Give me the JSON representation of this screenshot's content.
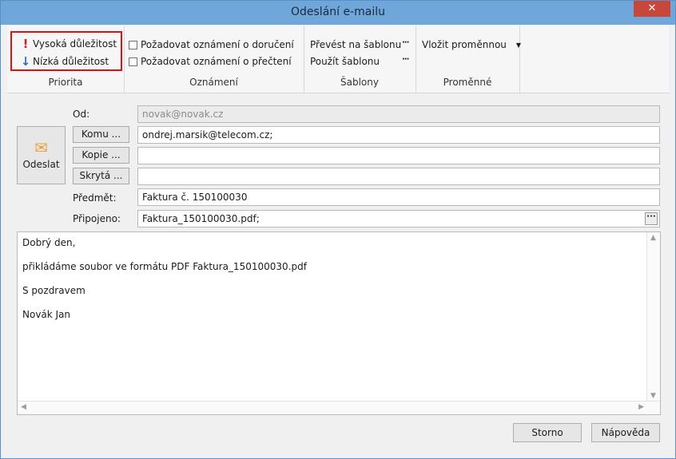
{
  "window": {
    "title": "Odeslání e-mailu",
    "close_label": "✕"
  },
  "ribbon": {
    "priority": {
      "high": "Vysoká důležitost",
      "low": "Nízká důležitost",
      "label": "Priorita"
    },
    "notifications": {
      "delivery": "Požadovat oznámení o doručení",
      "read": "Požadovat oznámení o přečtení",
      "label": "Oznámení"
    },
    "templates": {
      "convert": "Převést na šablonu",
      "use": "Použít šablonu",
      "label": "Šablony"
    },
    "variables": {
      "insert": "Vložit proměnnou",
      "label": "Proměnné"
    }
  },
  "form": {
    "send_label": "Odeslat",
    "from_label": "Od:",
    "from_value": "novak@novak.cz",
    "to_button": "Komu ...",
    "to_value": "ondrej.marsik@telecom.cz;",
    "cc_button": "Kopie ...",
    "cc_value": "",
    "bcc_button": "Skrytá ...",
    "bcc_value": "",
    "subject_label": "Předmět:",
    "subject_value": "Faktura č. 150100030",
    "attached_label": "Připojeno:",
    "attached_value": "Faktura_150100030.pdf;"
  },
  "message": {
    "lines": [
      "Dobrý den,",
      "přikládáme soubor ve formátu PDF Faktura_150100030.pdf",
      "S pozdravem",
      "Novák Jan"
    ]
  },
  "buttons": {
    "cancel": "Storno",
    "help": "Nápověda"
  }
}
